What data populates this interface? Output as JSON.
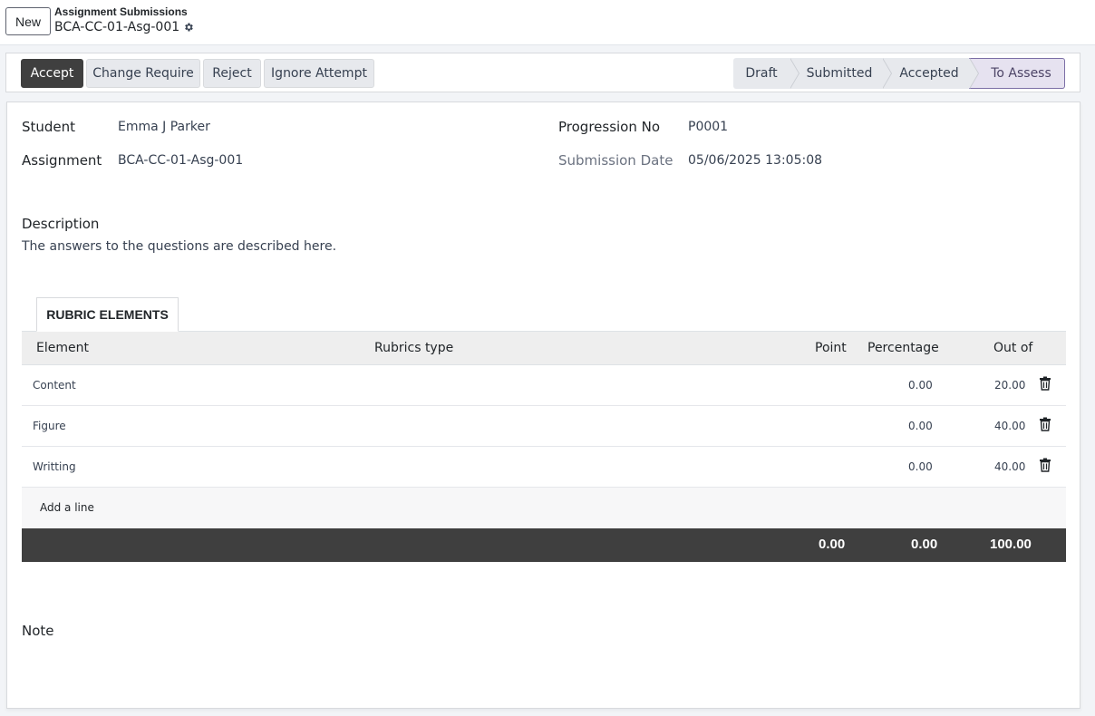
{
  "header": {
    "new_label": "New",
    "breadcrumb_parent": "Assignment Submissions",
    "record_name": "BCA-CC-01-Asg-001"
  },
  "actions": {
    "accept": "Accept",
    "change_require": "Change Require",
    "reject": "Reject",
    "ignore_attempt": "Ignore Attempt"
  },
  "stages": [
    {
      "label": "Draft"
    },
    {
      "label": "Submitted"
    },
    {
      "label": "Accepted"
    },
    {
      "label": "To Assess"
    }
  ],
  "active_stage": "To Assess",
  "fields": {
    "student_label": "Student",
    "student_value": "Emma J Parker",
    "assignment_label": "Assignment",
    "assignment_value": "BCA-CC-01-Asg-001",
    "progression_label": "Progression No",
    "progression_value": "P0001",
    "submission_date_label": "Submission Date",
    "submission_date_value": "05/06/2025 13:05:08",
    "description_label": "Description",
    "description_value": "The answers to the questions are described here.",
    "note_label": "Note"
  },
  "tabs": {
    "rubric_elements": "RUBRIC ELEMENTS"
  },
  "table": {
    "columns": {
      "element": "Element",
      "rubrics_type": "Rubrics type",
      "point": "Point",
      "percentage": "Percentage",
      "out_of": "Out of"
    },
    "rows": [
      {
        "element": "Content",
        "percentage": "0.00",
        "out_of": "20.00"
      },
      {
        "element": "Figure",
        "percentage": "0.00",
        "out_of": "40.00"
      },
      {
        "element": "Writting",
        "percentage": "0.00",
        "out_of": "40.00"
      }
    ],
    "add_line": "Add a line",
    "totals": {
      "point": "0.00",
      "percentage": "0.00",
      "out_of": "100.00"
    }
  },
  "colors": {
    "primary_button": "#3f3f3f",
    "active_stage_bg": "#e6e2f0",
    "active_stage_border": "#7c6fa6",
    "footer_bg": "#3f3f3f"
  },
  "icons": {
    "gear": "gear-icon",
    "trash": "trash-icon"
  }
}
